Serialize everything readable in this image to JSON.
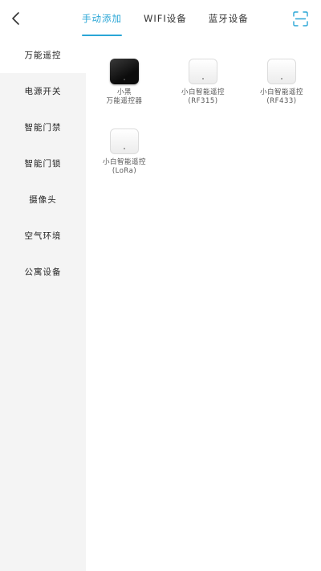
{
  "header": {
    "back_icon": "chevron-left-icon",
    "tabs": [
      {
        "label": "手动添加",
        "active": true
      },
      {
        "label": "WIFI设备",
        "active": false
      },
      {
        "label": "蓝牙设备",
        "active": false
      }
    ],
    "scan_icon": "scan-icon"
  },
  "accent_color": "#2aa6d6",
  "sidebar": {
    "items": [
      {
        "label": "万能遥控",
        "active": true
      },
      {
        "label": "电源开关"
      },
      {
        "label": "智能门禁"
      },
      {
        "label": "智能门锁"
      },
      {
        "label": "摄像头"
      },
      {
        "label": "空气环境"
      },
      {
        "label": "公寓设备"
      }
    ]
  },
  "devices": [
    {
      "line1": "小黑",
      "line2": "万能遥控器",
      "style": "black"
    },
    {
      "line1": "小白智能遥控",
      "line2": "(RF315)",
      "style": "white"
    },
    {
      "line1": "小白智能遥控",
      "line2": "(RF433)",
      "style": "white"
    },
    {
      "line1": "小白智能遥控",
      "line2": "(LoRa)",
      "style": "white"
    }
  ]
}
